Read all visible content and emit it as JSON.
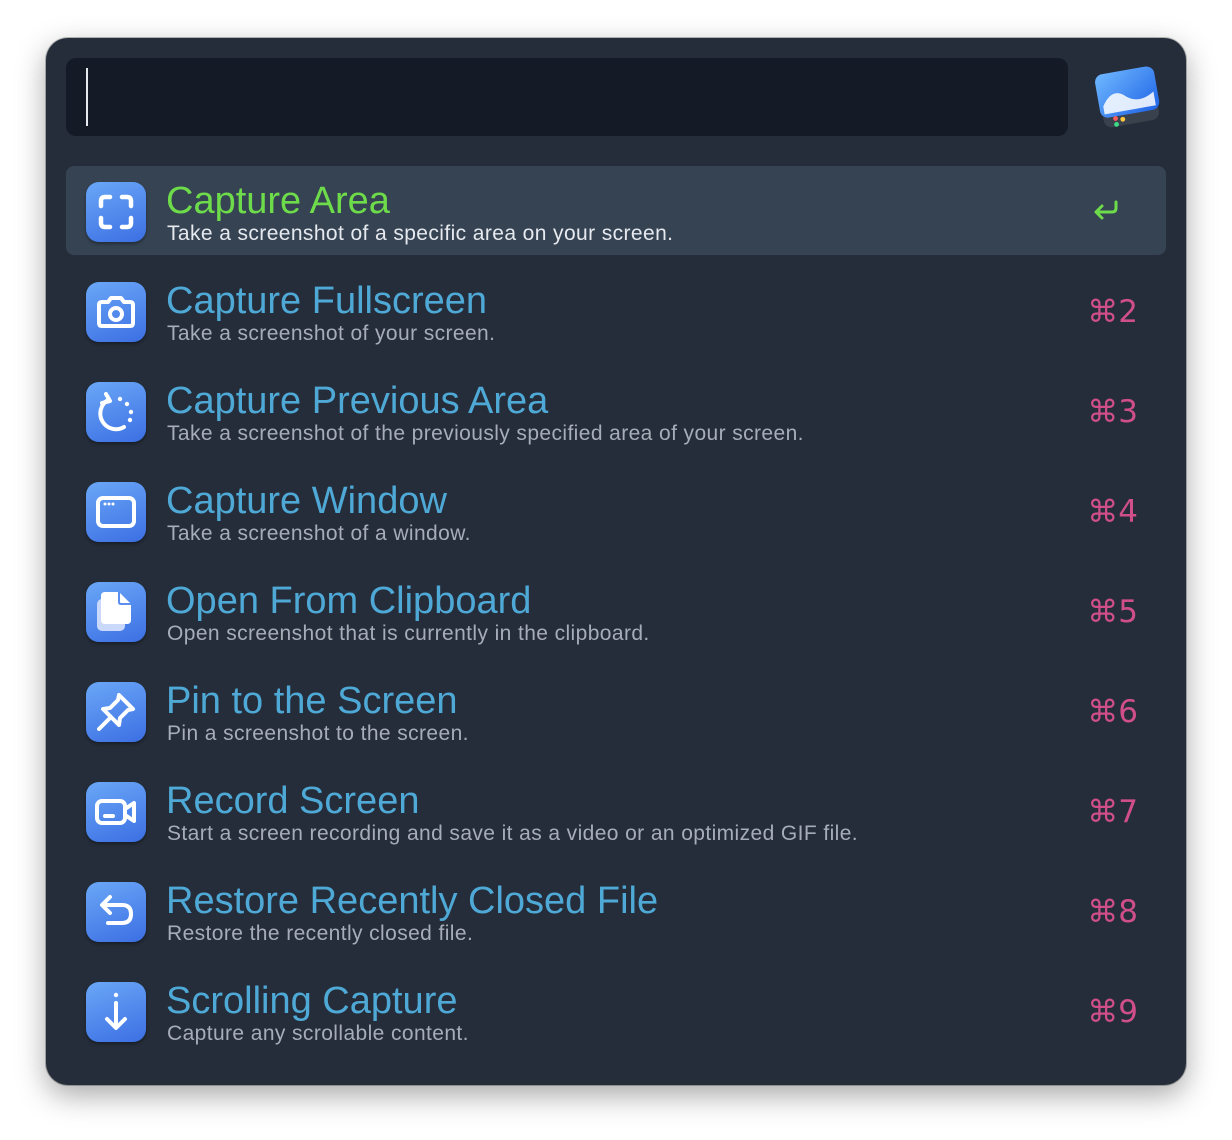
{
  "search": {
    "value": "",
    "placeholder": ""
  },
  "app_icon": "cleanshot-app-icon",
  "colors": {
    "window_bg": "#252d3a",
    "search_bg": "#141b26",
    "selected_bg": "#354353",
    "title": "#4fa9d6",
    "selected_title": "#6edb4a",
    "subtitle": "#a6adb8",
    "shortcut": "#d04f8a"
  },
  "items": [
    {
      "icon": "capture-area-icon",
      "title": "Capture Area",
      "subtitle": "Take a screenshot of a specific area on your screen.",
      "shortcut": "",
      "action_icon": "return-icon",
      "selected": true
    },
    {
      "icon": "camera-icon",
      "title": "Capture Fullscreen",
      "subtitle": "Take a screenshot of your screen.",
      "shortcut": "⌘2"
    },
    {
      "icon": "rotate-dashed-icon",
      "title": "Capture Previous Area",
      "subtitle": "Take a screenshot of the previously specified area of your screen.",
      "shortcut": "⌘3"
    },
    {
      "icon": "window-icon",
      "title": "Capture Window",
      "subtitle": "Take a screenshot of a window.",
      "shortcut": "⌘4"
    },
    {
      "icon": "clipboard-documents-icon",
      "title": "Open From Clipboard",
      "subtitle": "Open screenshot that is currently in the clipboard.",
      "shortcut": "⌘5"
    },
    {
      "icon": "pin-icon",
      "title": "Pin to the Screen",
      "subtitle": "Pin a screenshot to the screen.",
      "shortcut": "⌘6"
    },
    {
      "icon": "video-camera-icon",
      "title": "Record Screen",
      "subtitle": "Start a screen recording and save it as a video or an optimized GIF file.",
      "shortcut": "⌘7"
    },
    {
      "icon": "undo-arrow-icon",
      "title": "Restore Recently Closed File",
      "subtitle": "Restore the recently closed file.",
      "shortcut": "⌘8"
    },
    {
      "icon": "arrow-down-icon",
      "title": "Scrolling Capture",
      "subtitle": "Capture any scrollable content.",
      "shortcut": "⌘9"
    }
  ]
}
